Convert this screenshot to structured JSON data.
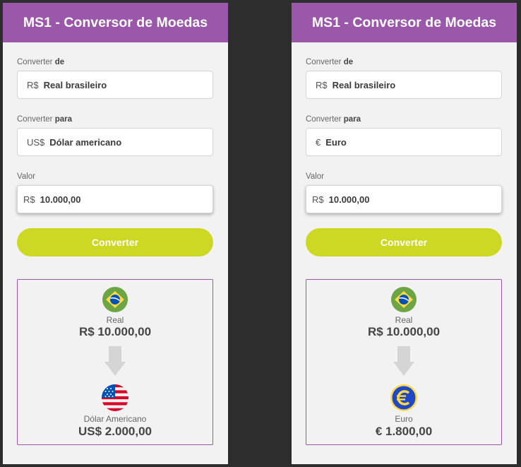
{
  "colors": {
    "page_background": "#2d2d2d",
    "header": "#9b57a9",
    "panel_background": "#f2f2f2",
    "button": "#cdd823",
    "result_border": "#9b57a9",
    "arrow": "#d5d5d5"
  },
  "panels": [
    {
      "title": "MS1 - Conversor de Moedas",
      "from": {
        "label": "Converter",
        "label_bold": "de",
        "symbol": "R$",
        "currency": "Real brasileiro"
      },
      "to": {
        "label": "Converter",
        "label_bold": "para",
        "symbol": "US$",
        "currency": "Dólar americano"
      },
      "amount": {
        "label": "Valor",
        "symbol": "R$",
        "value": "10.000,00"
      },
      "convert_button": "Converter",
      "result": {
        "source": {
          "icon": "brazil-flag-icon",
          "name": "Real",
          "amount": "R$ 10.000,00"
        },
        "arrow_icon": "arrow-down-icon",
        "target": {
          "icon": "usa-flag-icon",
          "name": "Dólar Americano",
          "amount": "US$ 2.000,00"
        }
      }
    },
    {
      "title": "MS1 - Conversor de Moedas",
      "from": {
        "label": "Converter",
        "label_bold": "de",
        "symbol": "R$",
        "currency": "Real brasileiro"
      },
      "to": {
        "label": "Converter",
        "label_bold": "para",
        "symbol": "€",
        "currency": "Euro"
      },
      "amount": {
        "label": "Valor",
        "symbol": "R$",
        "value": "10.000,00"
      },
      "convert_button": "Converter",
      "result": {
        "source": {
          "icon": "brazil-flag-icon",
          "name": "Real",
          "amount": "R$ 10.000,00"
        },
        "arrow_icon": "arrow-down-icon",
        "target": {
          "icon": "euro-coin-icon",
          "name": "Euro",
          "amount": "€ 1.800,00"
        }
      }
    }
  ]
}
